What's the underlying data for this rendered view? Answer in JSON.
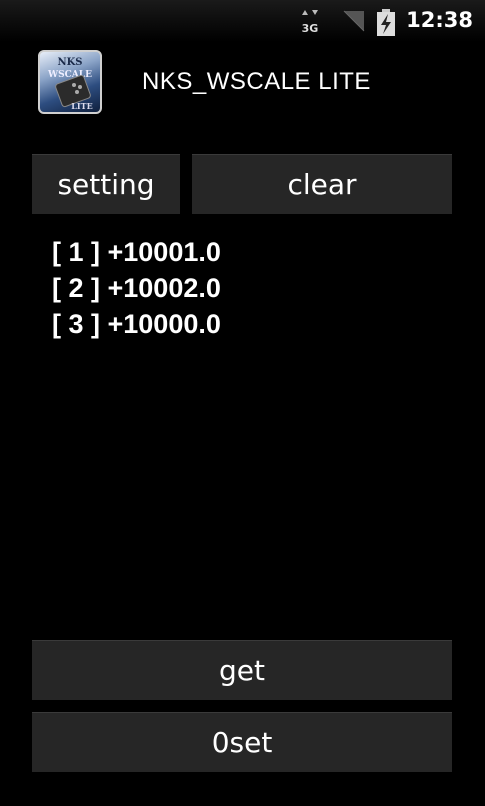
{
  "status_bar": {
    "network_label": "3G",
    "time": "12:38",
    "icons": [
      "network-3g-icon",
      "signal-icon",
      "battery-charging-icon"
    ]
  },
  "app": {
    "icon_text_top": "NKS",
    "icon_text_mid": "WSCALE",
    "icon_text_bottom": "LITE",
    "title": "NKS_WSCALE LITE"
  },
  "buttons": {
    "setting": "setting",
    "clear": "clear",
    "get": "get",
    "zeroset": "0set"
  },
  "readings": [
    "[ 1 ] +10001.0",
    "[ 2 ] +10002.0",
    "[ 3 ] +10000.0"
  ],
  "colors": {
    "background": "#000000",
    "button_bg": "#262626",
    "text": "#ffffff"
  }
}
